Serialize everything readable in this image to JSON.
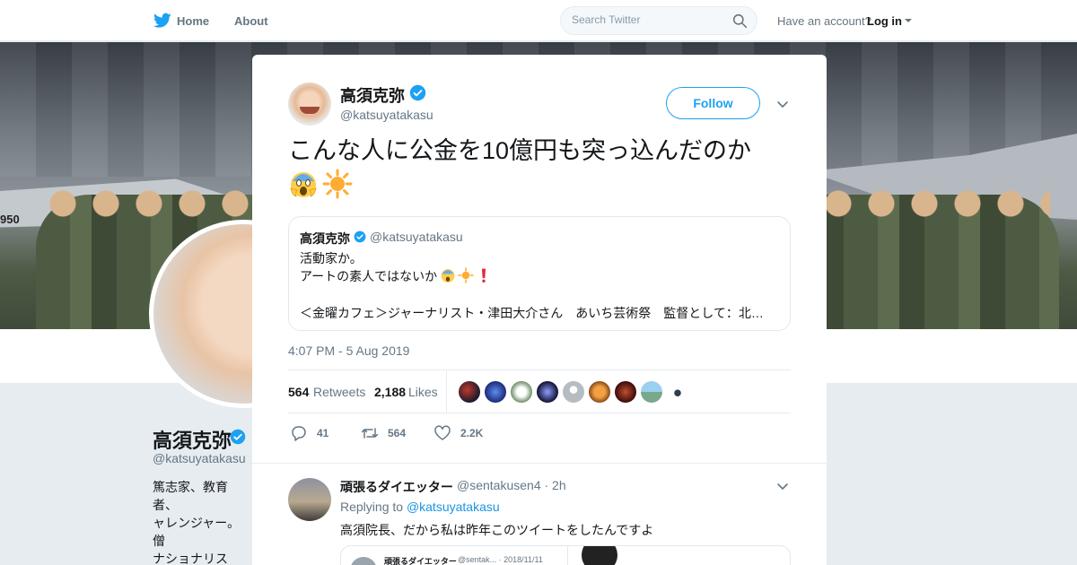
{
  "topnav": {
    "home": "Home",
    "about": "About",
    "search_placeholder": "Search Twitter",
    "have_account": "Have an account?",
    "login": "Log in"
  },
  "background_profile": {
    "banner_label": "950",
    "name": "高須克弥",
    "handle": "@katsuyatakasu",
    "bio": "篤志家、教育者、\nャレンジャー。僧\nナショナリスト。\n癌。ついはい。ち\nもできる。"
  },
  "tweet": {
    "author_name": "高須克弥",
    "author_handle": "@katsuyatakasu",
    "follow_label": "Follow",
    "text": "こんな人に公金を10億円も突っ込んだのか",
    "emojis": [
      "face-screaming-icon",
      "sun-icon"
    ],
    "quote": {
      "name": "高須克弥",
      "handle": "@katsuyatakasu",
      "line1": "活動家か。",
      "line2": "アートの素人ではないか",
      "line3": "＜金曜カフェ＞ジャーナリスト・津田大介さん　あいち芸術祭　監督として：北…"
    },
    "timestamp": "4:07 PM - 5 Aug 2019",
    "retweets_count": "564",
    "retweets_label": "Retweets",
    "likes_count": "2,188",
    "likes_label": "Likes",
    "actions": {
      "reply": "41",
      "retweet": "564",
      "like": "2.2K"
    }
  },
  "reply": {
    "name": "頑張るダイエッター",
    "handle": "@sentakusen4 · 2h",
    "replying_prefix": "Replying to",
    "replying_to": "@katsuyatakasu",
    "text": "高須院長、だから私は昨年このツイートをしたんですよ",
    "media_name": "頑張るダイエッター",
    "media_handle": "@sentak... · 2018/11/11"
  },
  "colors": {
    "accent": "#1da1f2",
    "verified": "#1da1f2"
  }
}
